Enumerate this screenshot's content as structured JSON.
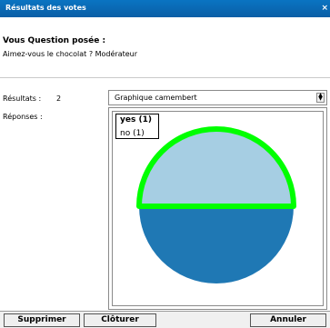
{
  "window": {
    "title": "Résultats des votes",
    "close_glyph": "×"
  },
  "question": {
    "heading": "Vous Question posée :",
    "text": "Aimez-vous le chocolat ?   Modérateur"
  },
  "results": {
    "label": "Résultats :",
    "count": "2"
  },
  "chart_select": {
    "value": "Graphique camembert"
  },
  "responses": {
    "label": "Réponses :"
  },
  "legend": {
    "yes": "yes (1)",
    "no": "no (1)"
  },
  "chart_data": {
    "type": "pie",
    "categories": [
      "yes",
      "no"
    ],
    "values": [
      1,
      1
    ],
    "colors": [
      "#a6cee3",
      "#1f78b4"
    ],
    "highlight_color": "#00ff00",
    "highlighted": "yes"
  },
  "buttons": {
    "delete": "Supprimer",
    "close": "Clôturer",
    "cancel": "Annuler"
  }
}
